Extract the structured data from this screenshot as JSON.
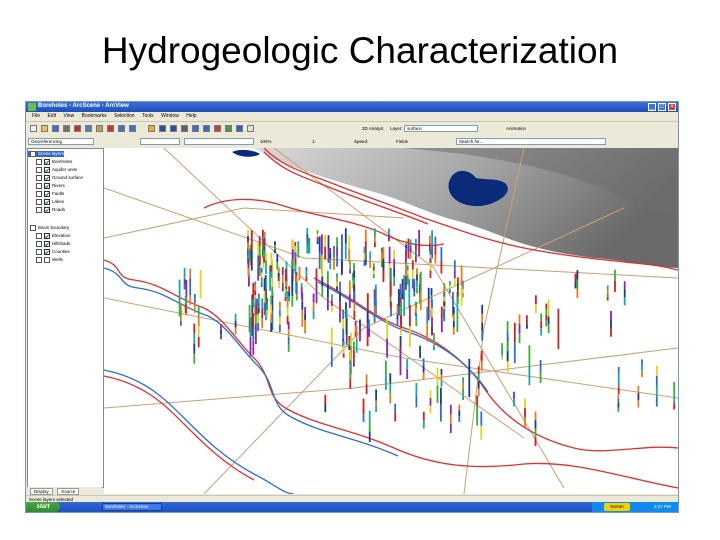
{
  "slide": {
    "title": "Hydrogeologic Characterization"
  },
  "window": {
    "title": "Boreholes - ArcScene - ArcView",
    "controls": {
      "minimize": "_",
      "maximize": "□",
      "close": "×"
    }
  },
  "menu": [
    "File",
    "Edit",
    "View",
    "Bookmarks",
    "Selection",
    "Tools",
    "Window",
    "Help"
  ],
  "toolbar1": {
    "analysis_label": "3D Analyst",
    "layer_label": "Layer:",
    "layer_value": "surface",
    "animation_label": "Animation"
  },
  "toolbar2": {
    "field1": "Georeferencing",
    "field2": "",
    "field3": "",
    "zoom_label": "100%",
    "scale_label": "1:",
    "speed_label": "Speed:",
    "fields_label": "Fields",
    "search_placeholder": "Search for..."
  },
  "toc": {
    "items": [
      {
        "label": "Scene layers",
        "indent": 0,
        "checked": false,
        "selected": true
      },
      {
        "label": "Boreholes",
        "indent": 1,
        "checked": true,
        "selected": false
      },
      {
        "label": "Aquifer units",
        "indent": 1,
        "checked": true,
        "selected": false
      },
      {
        "label": "Ground surface",
        "indent": 1,
        "checked": true,
        "selected": false
      },
      {
        "label": "Rivers",
        "indent": 1,
        "checked": true,
        "selected": false
      },
      {
        "label": "Faults",
        "indent": 1,
        "checked": true,
        "selected": false
      },
      {
        "label": "Lakes",
        "indent": 1,
        "checked": true,
        "selected": false
      },
      {
        "label": "Roads",
        "indent": 1,
        "checked": true,
        "selected": false
      },
      {
        "label": "Basin boundary",
        "indent": 0,
        "checked": false,
        "selected": false
      },
      {
        "label": "Elevation",
        "indent": 1,
        "checked": true,
        "selected": false
      },
      {
        "label": "Hillshade",
        "indent": 1,
        "checked": true,
        "selected": false
      },
      {
        "label": "Counties",
        "indent": 1,
        "checked": true,
        "selected": false
      },
      {
        "label": "Wells",
        "indent": 1,
        "checked": false,
        "selected": false
      }
    ],
    "tabs": [
      "Display",
      "Source"
    ]
  },
  "status": {
    "text": "Scene layers selected"
  },
  "taskbar": {
    "start": "start",
    "item": "Boreholes - ArcScene",
    "tray": "Norton",
    "clock": "3:37 PM"
  },
  "colors": {
    "river": "#e03030",
    "road": "#c8a070",
    "lake": "#0a2a7a",
    "terrain_dark": "#7a7a7a",
    "terrain_light": "#f4f4f4",
    "borehole_colors": [
      "#1f3a8a",
      "#2f6fd0",
      "#18a8a8",
      "#38b038",
      "#d8d820",
      "#e08020",
      "#d02020",
      "#8a2aa8"
    ]
  },
  "icons": [
    "new-file-icon",
    "open-folder-icon",
    "save-icon",
    "print-icon",
    "cut-icon",
    "copy-icon",
    "paste-icon",
    "delete-icon",
    "undo-icon",
    "redo-icon",
    "add-data-icon",
    "zoom-in-icon",
    "zoom-out-icon",
    "pan-icon",
    "full-extent-icon",
    "identify-icon",
    "measure-icon",
    "navigate-icon",
    "fly-icon",
    "select-icon"
  ]
}
